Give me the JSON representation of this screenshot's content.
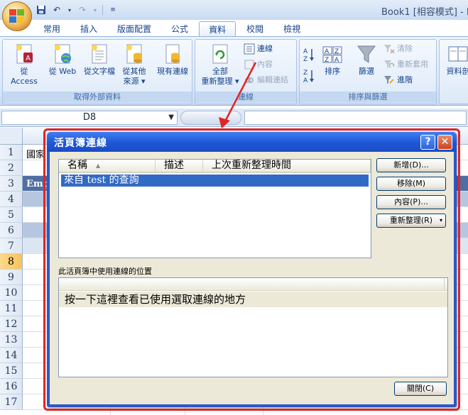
{
  "app": {
    "title": "Book1 [相容模式] - M"
  },
  "ribbon": {
    "tabs": [
      {
        "label": "常用"
      },
      {
        "label": "插入"
      },
      {
        "label": "版面配置"
      },
      {
        "label": "公式"
      },
      {
        "label": "資料"
      },
      {
        "label": "校閱"
      },
      {
        "label": "檢視"
      }
    ],
    "get_external_data": {
      "group_label": "取得外部資料",
      "from_access": "從 Access",
      "from_web": "從 Web",
      "from_text": "從文字檔",
      "from_other_1": "從其他",
      "from_other_2": "來源 ▾",
      "existing_connections": "現有連線"
    },
    "connections": {
      "group_label": "連線",
      "refresh_all_1": "全部",
      "refresh_all_2": "重新整理 ▾",
      "connections": "連線",
      "properties": "內容",
      "edit_links": "編輯連結"
    },
    "sort_filter": {
      "group_label": "排序與篩選",
      "sort": "排序",
      "filter": "篩選",
      "clear": "清除",
      "reapply": "重新套用",
      "advanced": "進階"
    },
    "data_tools": {
      "label": "資料剖"
    }
  },
  "formula_bar": {
    "name_box": "D8"
  },
  "sheet": {
    "rows": [
      "1",
      "2",
      "3",
      "4",
      "5",
      "6",
      "7",
      "8",
      "9",
      "10",
      "11",
      "12",
      "13",
      "14",
      "15",
      "16",
      "17"
    ],
    "a1_text": "國家",
    "a3_text": "Empl"
  },
  "dialog": {
    "title": "活頁簿連線",
    "help": "?",
    "close": "✕",
    "columns": {
      "name": "名稱",
      "description": "描述",
      "last_refreshed": "上次重新整理時間"
    },
    "connections": [
      {
        "name": "來自 test 的查詢"
      }
    ],
    "buttons": {
      "add": "新增(D)...",
      "remove": "移除(M)",
      "properties": "內容(P)...",
      "refresh": "重新整理(R)"
    },
    "locations_label": "此活頁簿中使用連線的位置",
    "locations_message": "按一下這裡查看已使用選取連線的地方",
    "close_button": "關閉(C)"
  },
  "colors": {
    "accent": "#2958c9",
    "annotation": "#e02424",
    "selection": "#316ac5"
  }
}
